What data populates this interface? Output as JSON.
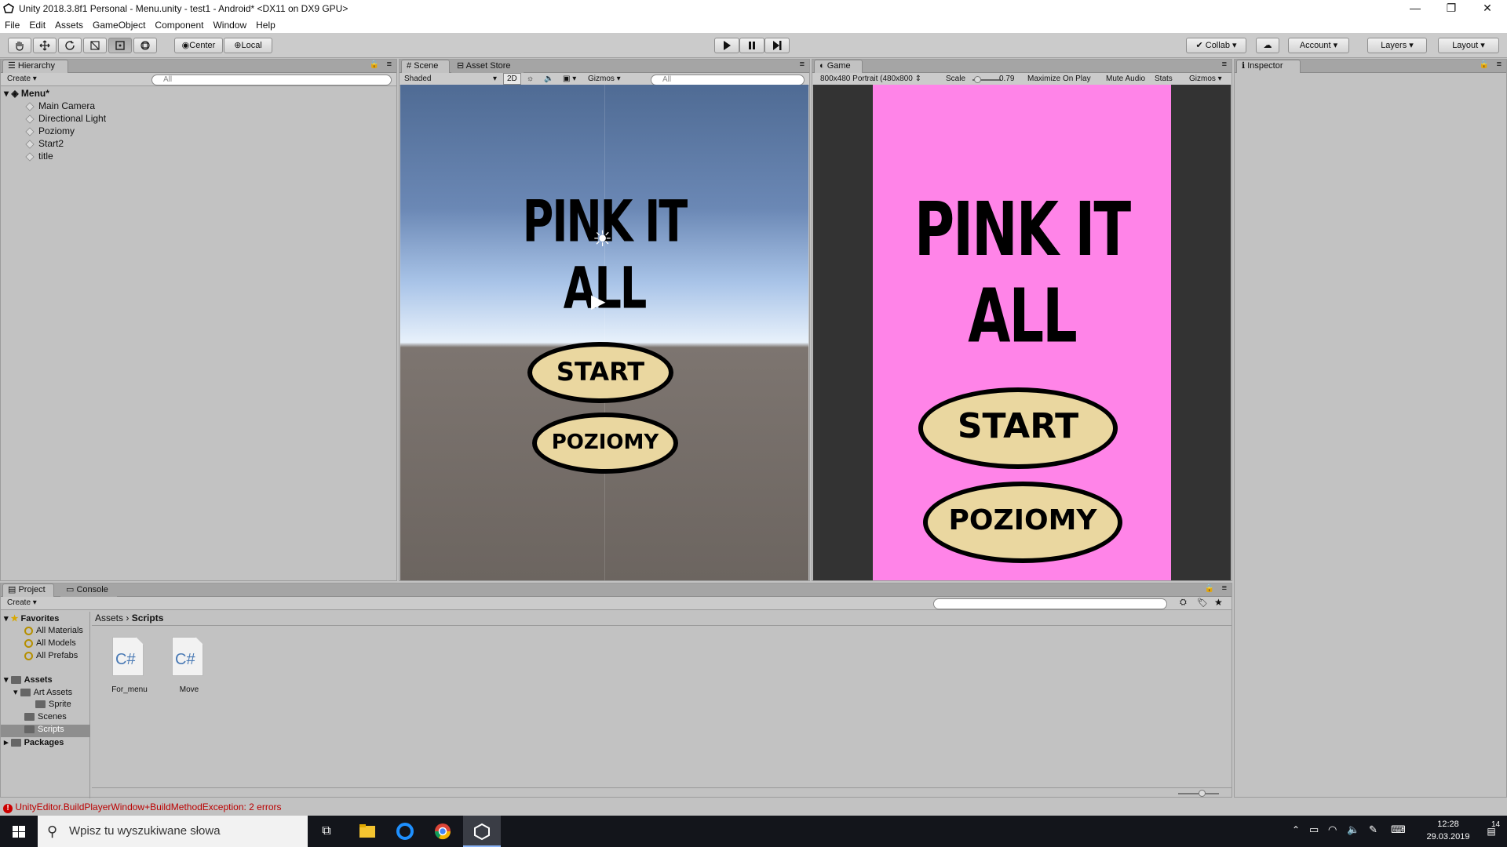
{
  "window": {
    "title": "Unity 2018.3.8f1 Personal - Menu.unity - test1 - Android* <DX11 on DX9 GPU>",
    "controls": [
      "—",
      "❐",
      "✕"
    ]
  },
  "menubar": [
    "File",
    "Edit",
    "Assets",
    "GameObject",
    "Component",
    "Window",
    "Help"
  ],
  "toolbar": {
    "pivot_center": "Center",
    "pivot_local": "Local",
    "collab": "Collab",
    "account": "Account",
    "layers": "Layers",
    "layout": "Layout"
  },
  "hierarchy": {
    "tab": "Hierarchy",
    "create": "Create",
    "search_placeholder": "All",
    "scene_name": "Menu*",
    "items": [
      "Main Camera",
      "Directional Light",
      "Poziomy",
      "Start2",
      "title"
    ]
  },
  "scene": {
    "tab": "Scene",
    "tab2": "Asset Store",
    "shading": "Shaded",
    "mode_2d": "2D",
    "gizmos": "Gizmos",
    "search_placeholder": "All",
    "title_text": "PINK IT ALL",
    "btn_start": "START",
    "btn_levels": "POZIOMY"
  },
  "game": {
    "tab": "Game",
    "resolution": "800x480 Portrait (480x800",
    "scale_label": "Scale",
    "scale_value": "0.79",
    "maximize": "Maximize On Play",
    "mute": "Mute Audio",
    "stats": "Stats",
    "gizmos": "Gizmos",
    "title_text": "PINK IT ALL",
    "btn_start": "START",
    "btn_levels": "POZIOMY",
    "bg_color": "#ff84e8"
  },
  "inspector": {
    "tab": "Inspector"
  },
  "project": {
    "tab": "Project",
    "tab2": "Console",
    "create": "Create",
    "breadcrumb_root": "Assets",
    "breadcrumb_current": "Scripts",
    "favorites_label": "Favorites",
    "favorites": [
      "All Materials",
      "All Models",
      "All Prefabs"
    ],
    "assets_label": "Assets",
    "art_assets": "Art Assets",
    "sprite": "Sprite",
    "scenes": "Scenes",
    "scripts": "Scripts",
    "packages": "Packages",
    "files": [
      {
        "icon": "C#",
        "name": "For_menu"
      },
      {
        "icon": "C#",
        "name": "Move"
      }
    ]
  },
  "status": {
    "error": "UnityEditor.BuildPlayerWindow+BuildMethodException: 2 errors"
  },
  "taskbar": {
    "search_placeholder": "Wpisz tu wyszukiwane słowa",
    "time": "12:28",
    "date": "29.03.2019",
    "notifications": "14"
  }
}
